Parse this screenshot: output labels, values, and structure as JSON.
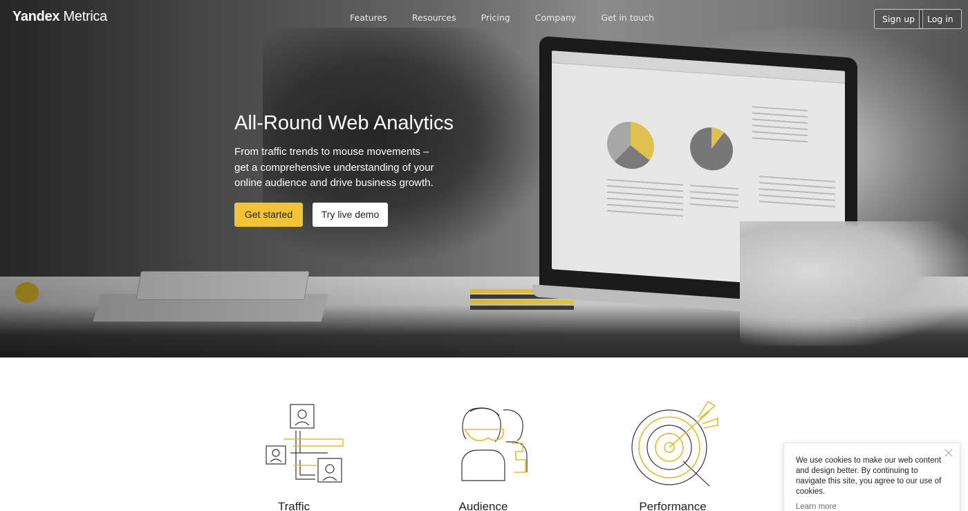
{
  "brand": {
    "part1": "Yandex",
    "part2": "Metrica"
  },
  "nav": {
    "links": [
      "Features",
      "Resources",
      "Pricing",
      "Company",
      "Get in touch"
    ],
    "signup": "Sign up",
    "login": "Log in"
  },
  "hero": {
    "title": "All-Round Web Analytics",
    "subtitle": "From traffic trends to mouse movements – get a comprehensive understanding of your online audience and drive business growth.",
    "primary_button": "Get started",
    "secondary_button": "Try live demo"
  },
  "features": [
    {
      "title": "Traffic",
      "icon": "traffic-icon"
    },
    {
      "title": "Audience",
      "icon": "audience-icon"
    },
    {
      "title": "Performance",
      "icon": "performance-icon"
    }
  ],
  "cookie": {
    "text": "We use cookies to make our web content and design better. By continuing to navigate this site, you agree to our use of cookies.",
    "link": "Learn more"
  },
  "colors": {
    "accent": "#f2c336",
    "text": "#222222",
    "icon_stroke": "#333333"
  }
}
